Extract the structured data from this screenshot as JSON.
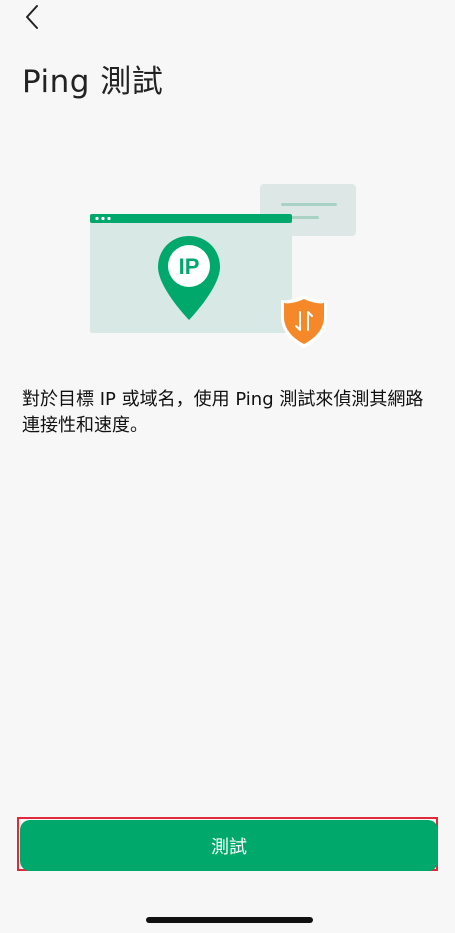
{
  "header": {
    "title": "Ping 測試",
    "back_icon": "chevron-left-icon"
  },
  "illustration": {
    "pin_label": "IP",
    "icons": [
      "browser-window-icon",
      "location-pin-icon",
      "shield-transfer-icon",
      "message-card-icon"
    ],
    "colors": {
      "primary_green": "#00a86b",
      "panel_light": "#d8e9e5",
      "shield_orange": "#f5892a"
    }
  },
  "description": "對於目標 IP 或域名，使用 Ping 測試來偵測其網路連接性和速度。",
  "action": {
    "test_label": "測試"
  },
  "colors": {
    "accent": "#00a86b",
    "highlight_border": "#e0293a",
    "background": "#f7f7f7"
  }
}
